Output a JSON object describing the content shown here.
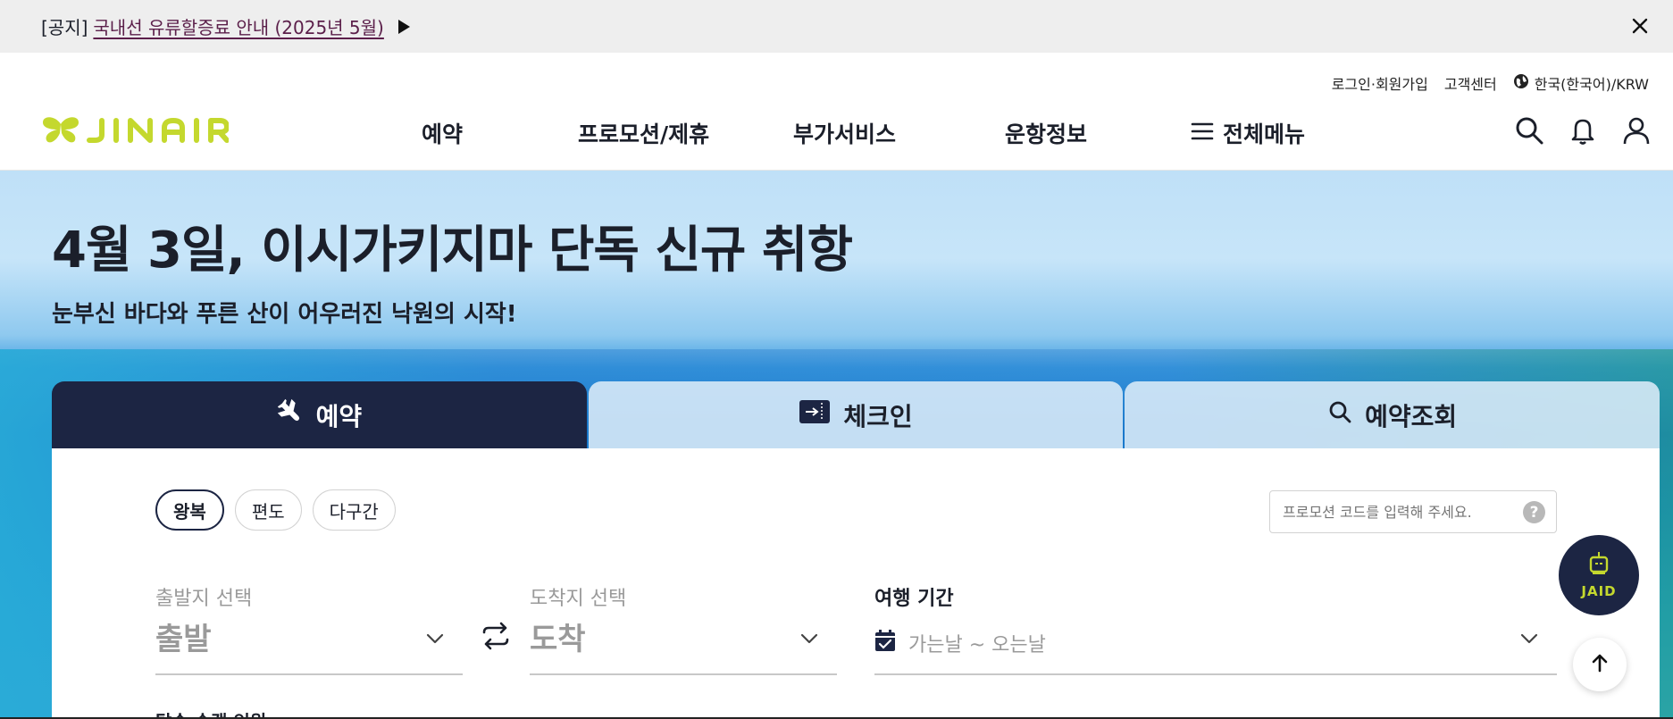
{
  "notice": {
    "tag": "[공지]",
    "link_text": "국내선 유류할증료 안내 (2025년 5월)"
  },
  "header": {
    "util": {
      "login": "로그인·회원가입",
      "support": "고객센터",
      "language": "한국(한국어)/KRW"
    },
    "logo_text": "JINAIR",
    "nav": [
      "예약",
      "프로모션/제휴",
      "부가서비스",
      "운항정보"
    ],
    "menu_all": "전체메뉴",
    "brand_color": "#c4d82e"
  },
  "hero": {
    "title": "4월 3일, 이시가키지마 단독 신규 취항",
    "subtitle": "눈부신 바다와 푸른 산이 어우러진 낙원의 시작!"
  },
  "booking": {
    "tabs": {
      "reserve": "예약",
      "checkin": "체크인",
      "lookup": "예약조회"
    },
    "trip_types": [
      "왕복",
      "편도",
      "다구간"
    ],
    "selected_trip_type": "왕복",
    "promo_placeholder": "프로모션 코드를 입력해 주세요.",
    "promo_help": "?",
    "origin": {
      "label": "출발지 선택",
      "value": "출발"
    },
    "destination": {
      "label": "도착지 선택",
      "value": "도착"
    },
    "period": {
      "label": "여행 기간",
      "value": "가는날 ~ 오는날"
    },
    "cut_label": "탑승 승객 인원"
  },
  "floating": {
    "assistant": "JAID"
  },
  "colors": {
    "navy": "#1c2543",
    "accent_lime": "#c4d82e"
  }
}
